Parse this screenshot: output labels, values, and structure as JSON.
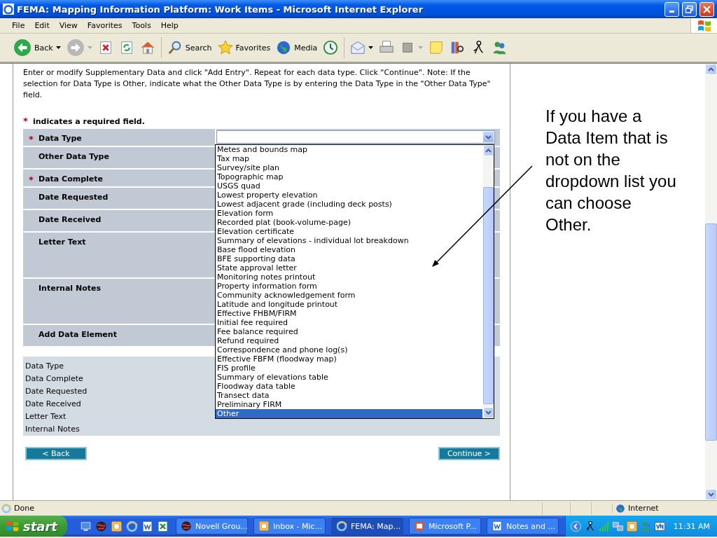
{
  "window": {
    "title": "FEMA: Mapping Information Platform: Work Items - Microsoft Internet Explorer"
  },
  "menu": [
    "File",
    "Edit",
    "View",
    "Favorites",
    "Tools",
    "Help"
  ],
  "toolbar": [
    {
      "kind": "back",
      "label": "Back",
      "has_menu": true
    },
    {
      "kind": "forward",
      "has_menu": true
    },
    {
      "kind": "stop",
      "has_menu": false
    },
    {
      "kind": "refresh",
      "has_menu": false
    },
    {
      "kind": "home",
      "has_menu": false
    },
    {
      "kind": "search",
      "label": "Search",
      "has_menu": false
    },
    {
      "kind": "favorites",
      "label": "Favorites",
      "has_menu": false
    },
    {
      "kind": "media",
      "label": "Media",
      "has_menu": false
    },
    {
      "kind": "history",
      "has_menu": false
    },
    {
      "kind": "mail",
      "has_menu": true
    },
    {
      "kind": "print",
      "has_menu": false
    },
    {
      "kind": "edit",
      "has_menu": true
    },
    {
      "kind": "note",
      "has_menu": false
    },
    {
      "kind": "research",
      "has_menu": false
    },
    {
      "kind": "messenger",
      "has_menu": false
    },
    {
      "kind": "people",
      "has_menu": false
    }
  ],
  "intro": "Enter or modify Supplementary Data and click \"Add Entry\". Repeat for each data type. Click \"Continue\". Note: If the selection for Data Type is Other, indicate what the Other Data Type is by entering the Data Type in the \"Other Data Type\" field.",
  "required_mark": "*",
  "required_note": "indicates a required field.",
  "form_rows": [
    {
      "label": "Data Type",
      "required": true,
      "kind": "select"
    },
    {
      "label": "Other Data Type",
      "required": false,
      "kind": "text"
    },
    {
      "label": "Data Complete",
      "required": true,
      "kind": "select"
    },
    {
      "label": "Date Requested",
      "required": false,
      "kind": "text"
    },
    {
      "label": "Date Received",
      "required": false,
      "kind": "text"
    },
    {
      "label": "Letter Text",
      "required": false,
      "kind": "textarea"
    },
    {
      "label": "Internal Notes",
      "required": false,
      "kind": "textarea"
    },
    {
      "label": "Add Data Element",
      "required": false,
      "kind": "text"
    }
  ],
  "data_type_dropdown": {
    "options": [
      {
        "label": "Metes and bounds map",
        "selected": false
      },
      {
        "label": "Tax map",
        "selected": false
      },
      {
        "label": "Survey/site plan",
        "selected": false
      },
      {
        "label": "Topographic map",
        "selected": false
      },
      {
        "label": "USGS quad",
        "selected": false
      },
      {
        "label": "Lowest property elevation",
        "selected": false
      },
      {
        "label": "Lowest adjacent grade (including deck posts)",
        "selected": false
      },
      {
        "label": "Elevation form",
        "selected": false
      },
      {
        "label": "Recorded plat (book-volume-page)",
        "selected": false
      },
      {
        "label": "Elevation certificate",
        "selected": false
      },
      {
        "label": "Summary of elevations - individual lot breakdown",
        "selected": false
      },
      {
        "label": "Base flood elevation",
        "selected": false
      },
      {
        "label": "BFE supporting data",
        "selected": false
      },
      {
        "label": "State approval letter",
        "selected": false
      },
      {
        "label": "Monitoring notes printout",
        "selected": false
      },
      {
        "label": "Property information form",
        "selected": false
      },
      {
        "label": "Community acknowledgement form",
        "selected": false
      },
      {
        "label": "Latitude and longitude printout",
        "selected": false
      },
      {
        "label": "Effective FHBM/FIRM",
        "selected": false
      },
      {
        "label": "Initial fee required",
        "selected": false
      },
      {
        "label": "Fee balance required",
        "selected": false
      },
      {
        "label": "Refund required",
        "selected": false
      },
      {
        "label": "Correspondence and phone log(s)",
        "selected": false
      },
      {
        "label": "Effective FBFM (floodway map)",
        "selected": false
      },
      {
        "label": "FIS profile",
        "selected": false
      },
      {
        "label": "Summary of elevations table",
        "selected": false
      },
      {
        "label": "Floodway data table",
        "selected": false
      },
      {
        "label": "Transect data",
        "selected": false
      },
      {
        "label": "Preliminary FIRM",
        "selected": false
      },
      {
        "label": "Other",
        "selected": true
      }
    ]
  },
  "summary": [
    "Data Type",
    "Data Complete",
    "Date Requested",
    "Date Received",
    "Letter Text",
    "Internal Notes"
  ],
  "buttons": {
    "back": "< Back",
    "continue": "Continue >"
  },
  "annotation": "If you have a Data Item that is not on the dropdown list you can choose Other.",
  "status_bar": {
    "text": "Done",
    "zone": "Internet"
  },
  "taskbar": {
    "start": "start",
    "tasks": [
      {
        "label": "Novell Grou...",
        "selected": false
      },
      {
        "label": "Inbox - Mic...",
        "selected": false
      },
      {
        "label": "FEMA: Map...",
        "selected": true
      },
      {
        "label": "Microsoft P...",
        "selected": false
      },
      {
        "label": "Notes and ...",
        "selected": false
      }
    ],
    "clock": "11:31 AM"
  }
}
